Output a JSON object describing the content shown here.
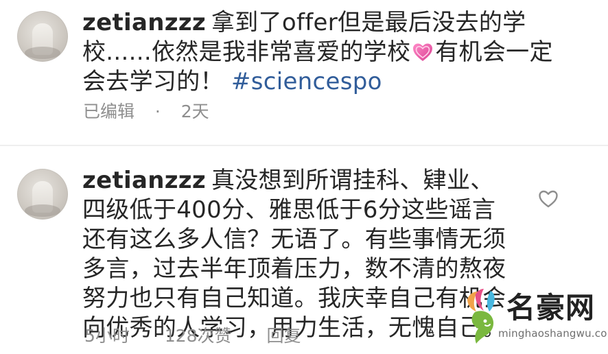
{
  "comments": [
    {
      "username": "zetianzzz",
      "body_part1": "拿到了offer但是最后没去的学校......依然是我非常喜爱的学校",
      "emoji": "heart-emoji",
      "body_part2": "有机会一定会去学习的！",
      "hashtag": "#sciencespo",
      "meta_edited": "已编辑",
      "meta_dot": "·",
      "meta_time": "2天"
    },
    {
      "username": "zetianzzz",
      "body": "真没想到所谓挂科、肄业、四级低于400分、雅思低于6分这些谣言还有这么多人信？无语了。有些事情无须多言，过去半年顶着压力，数不清的熬夜努力也只有自己知道。我庆幸自己有机会向优秀的人学习，用力生活，无愧自己。",
      "meta_time": "5小时",
      "meta_likes": "128次赞",
      "meta_reply": "回复",
      "like_icon": "heart-outline-icon"
    }
  ],
  "watermark": {
    "title": "名豪网",
    "site": "minghaoshangwu.com",
    "logo_icon": "leaf-head-logo-icon"
  },
  "colors": {
    "text": "#262626",
    "meta": "#8e8e8e",
    "hashtag": "#315d9a",
    "divider": "#efefef",
    "heart": "#e94f9d"
  }
}
